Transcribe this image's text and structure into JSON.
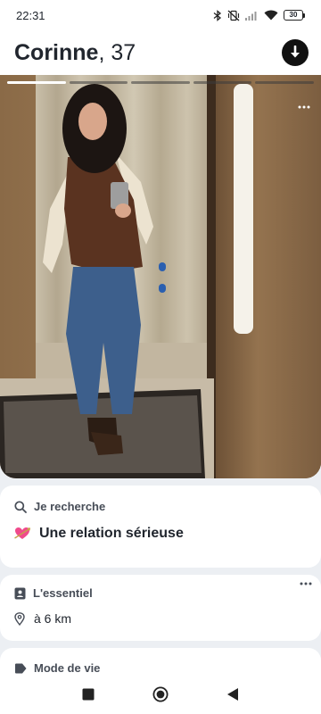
{
  "status_bar": {
    "time": "22:31",
    "battery_level": "30",
    "icons": [
      "bluetooth-icon",
      "vibrate-off-icon",
      "signal-icon",
      "wifi-icon",
      "battery-icon"
    ]
  },
  "header": {
    "name": "Corinne",
    "separator": ", ",
    "age": "37",
    "download_icon": "download-arrow-icon"
  },
  "photo": {
    "segments_total": 5,
    "active_segment": 1,
    "more_icon": "more-horizontal-icon",
    "colors": {
      "active_segment": "#ffffff",
      "inactive_segment": "#5a5a5a"
    }
  },
  "seeking": {
    "title": "Je recherche",
    "icon": "search-icon",
    "value_icon": "heart-arrow-emoji",
    "value": "Une relation sérieuse"
  },
  "essentials": {
    "title": "L'essentiel",
    "icon": "id-badge-icon",
    "more_icon": "more-horizontal-icon",
    "distance": "à 6 km",
    "distance_icon": "location-pin-icon"
  },
  "lifestyle": {
    "title": "Mode de vie",
    "icon": "tag-icon"
  },
  "nav_bar": {
    "icons": [
      "recent-apps-square-icon",
      "home-circle-icon",
      "back-triangle-icon"
    ]
  },
  "colors": {
    "background": "#eceff3",
    "card": "#ffffff",
    "text_primary": "#21262e",
    "text_secondary": "#474d57"
  }
}
